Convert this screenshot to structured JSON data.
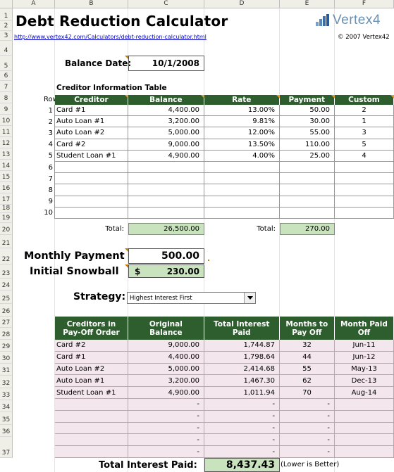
{
  "sheet": {
    "columns": [
      "A",
      "B",
      "C",
      "D",
      "E",
      "F"
    ],
    "rows": [
      "1",
      "2",
      "3",
      "4",
      "5",
      "6",
      "7",
      "8",
      "9",
      "10",
      "11",
      "12",
      "13",
      "14",
      "15",
      "16",
      "17",
      "18",
      "19",
      "20",
      "21",
      "22",
      "23",
      "24",
      "25",
      "26",
      "27",
      "28",
      "29",
      "30",
      "31",
      "32",
      "33",
      "34",
      "35",
      "36",
      "37"
    ]
  },
  "header": {
    "title": "Debt Reduction Calculator",
    "logo_text": "Vertex4",
    "url": "http://www.vertex42.com/Calculators/debt-reduction-calculator.html",
    "copyright": "© 2007 Vertex42"
  },
  "balance_date": {
    "label": "Balance Date:",
    "value": "10/1/2008"
  },
  "creditor_table": {
    "title": "Creditor Information Table",
    "row_label": "Row",
    "headers": [
      "Creditor",
      "Balance",
      "Rate",
      "Payment",
      "Custom"
    ],
    "rows": [
      {
        "n": "1",
        "creditor": "Card #1",
        "balance": "4,400.00",
        "rate": "13.00%",
        "payment": "50.00",
        "custom": "2"
      },
      {
        "n": "2",
        "creditor": "Auto Loan #1",
        "balance": "3,200.00",
        "rate": "9.81%",
        "payment": "30.00",
        "custom": "1"
      },
      {
        "n": "3",
        "creditor": "Auto Loan #2",
        "balance": "5,000.00",
        "rate": "12.00%",
        "payment": "55.00",
        "custom": "3"
      },
      {
        "n": "4",
        "creditor": "Card #2",
        "balance": "9,000.00",
        "rate": "13.50%",
        "payment": "110.00",
        "custom": "5"
      },
      {
        "n": "5",
        "creditor": "Student Loan #1",
        "balance": "4,900.00",
        "rate": "4.00%",
        "payment": "25.00",
        "custom": "4"
      },
      {
        "n": "6",
        "creditor": "",
        "balance": "",
        "rate": "",
        "payment": "",
        "custom": ""
      },
      {
        "n": "7",
        "creditor": "",
        "balance": "",
        "rate": "",
        "payment": "",
        "custom": ""
      },
      {
        "n": "8",
        "creditor": "",
        "balance": "",
        "rate": "",
        "payment": "",
        "custom": ""
      },
      {
        "n": "9",
        "creditor": "",
        "balance": "",
        "rate": "",
        "payment": "",
        "custom": ""
      },
      {
        "n": "10",
        "creditor": "",
        "balance": "",
        "rate": "",
        "payment": "",
        "custom": ""
      }
    ],
    "total_label_1": "Total:",
    "total_balance": "26,500.00",
    "total_label_2": "Total:",
    "total_payment": "270.00"
  },
  "monthly_payment": {
    "label": "Monthly Payment",
    "value": "500.00"
  },
  "initial_snowball": {
    "label": "Initial Snowball",
    "currency": "$",
    "value": "230.00"
  },
  "strategy": {
    "label": "Strategy:",
    "value": "Highest Interest First"
  },
  "payoff_table": {
    "headers": [
      {
        "l1": "Creditors in",
        "l2": "Pay-Off Order"
      },
      {
        "l1": "Original",
        "l2": "Balance"
      },
      {
        "l1": "Total Interest",
        "l2": "Paid"
      },
      {
        "l1": "Months to",
        "l2": "Pay Off"
      },
      {
        "l1": "Month Paid",
        "l2": "Off"
      }
    ],
    "rows": [
      {
        "creditor": "Card #2",
        "balance": "9,000.00",
        "interest": "1,744.87",
        "months": "32",
        "paid_off": "Jun-11"
      },
      {
        "creditor": "Card #1",
        "balance": "4,400.00",
        "interest": "1,798.64",
        "months": "44",
        "paid_off": "Jun-12"
      },
      {
        "creditor": "Auto Loan #2",
        "balance": "5,000.00",
        "interest": "2,414.68",
        "months": "55",
        "paid_off": "May-13"
      },
      {
        "creditor": "Auto Loan #1",
        "balance": "3,200.00",
        "interest": "1,467.30",
        "months": "62",
        "paid_off": "Dec-13"
      },
      {
        "creditor": "Student Loan #1",
        "balance": "4,900.00",
        "interest": "1,011.94",
        "months": "70",
        "paid_off": "Aug-14"
      },
      {
        "creditor": "",
        "balance": "-",
        "interest": "-",
        "months": "-",
        "paid_off": ""
      },
      {
        "creditor": "",
        "balance": "-",
        "interest": "-",
        "months": "-",
        "paid_off": ""
      },
      {
        "creditor": "",
        "balance": "-",
        "interest": "-",
        "months": "-",
        "paid_off": ""
      },
      {
        "creditor": "",
        "balance": "-",
        "interest": "-",
        "months": "-",
        "paid_off": ""
      },
      {
        "creditor": "",
        "balance": "-",
        "interest": "-",
        "months": "-",
        "paid_off": ""
      }
    ],
    "total_label": "Total Interest Paid:",
    "total_value": "8,437.43",
    "total_note": "(Lower is Better)"
  },
  "colors": {
    "header_green": "#2e5e2e",
    "input_green": "#c9e3bf",
    "result_pink": "#f3e6ec",
    "comment_marker": "#c87c00"
  }
}
